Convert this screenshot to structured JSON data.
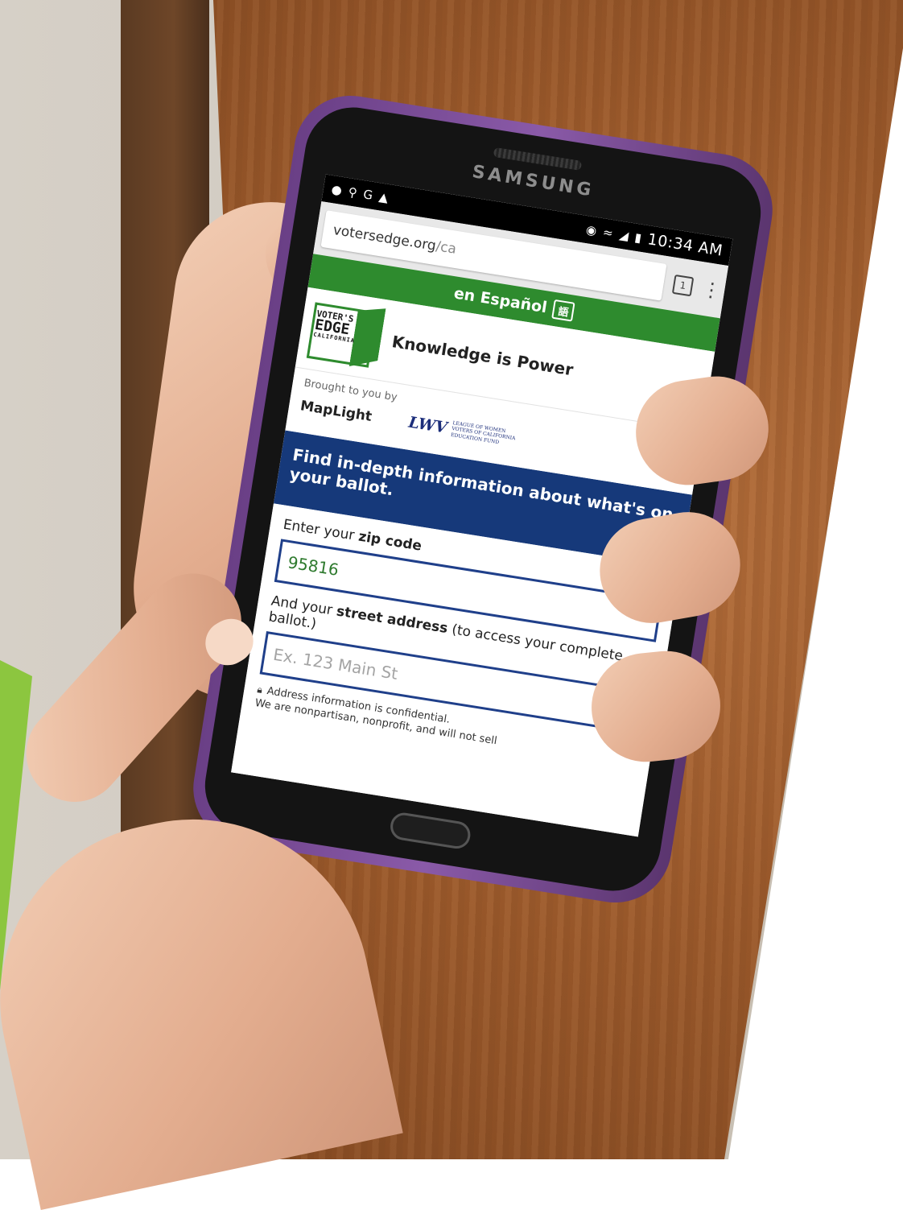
{
  "phone": {
    "brand": "SAMSUNG"
  },
  "status_bar": {
    "left_icons": [
      "chat-icon",
      "search-icon",
      "google-icon",
      "app-icon"
    ],
    "google_glyph": "G",
    "time": "10:34 AM"
  },
  "browser": {
    "url_host": "votersedge.org",
    "url_path": "/ca",
    "tab_count": "1",
    "menu_glyph": "⋮"
  },
  "page": {
    "language_link": "en Español",
    "language_icon_glyph": "語",
    "logo": {
      "line1": "VOTER'S",
      "line2": "EDGE",
      "line3": "CALIFORNIA"
    },
    "tagline": "Knowledge is Power",
    "sponsors": {
      "brought_by": "Brought to you by",
      "maplight": "MapLight",
      "lwv_mark": "LWV",
      "lwv_text": "LEAGUE OF WOMEN VOTERS OF CALIFORNIA EDUCATION FUND"
    },
    "cta": "Find in-depth information about what's on your ballot.",
    "zip": {
      "label_prefix": "Enter your ",
      "label_bold": "zip code",
      "value": "95816"
    },
    "address": {
      "label_prefix": "And your ",
      "label_bold": "street address",
      "label_suffix": " (to access your complete ballot.)",
      "placeholder": "Ex. 123 Main St"
    },
    "confidential": "Address information is confidential.",
    "disclaimer": "We are nonpartisan, nonprofit, and will not sell"
  },
  "colors": {
    "accent_green": "#2e8b2e",
    "cta_blue": "#16397a",
    "slide_accent": "#8cc63f",
    "phone_case": "#7a4c98"
  }
}
